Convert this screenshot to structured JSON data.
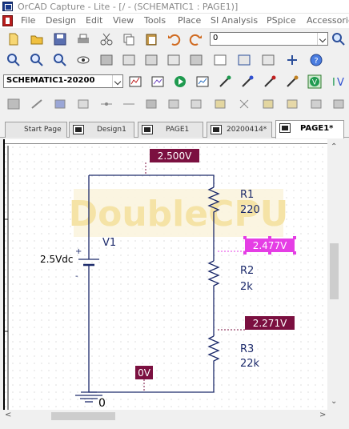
{
  "window": {
    "title": "OrCAD Capture - Lite - [/ - (SCHEMATIC1 : PAGE1)]"
  },
  "menu": [
    "File",
    "Design",
    "Edit",
    "View",
    "Tools",
    "Place",
    "SI Analysis",
    "PSpice",
    "Accessories"
  ],
  "toolbar": {
    "part_combo_value": "0",
    "schematic_combo_value": "SCHEMATIC1-20200"
  },
  "tabs": [
    {
      "label": "Start Page",
      "icon": "none"
    },
    {
      "label": "Design1",
      "icon": "design-icon"
    },
    {
      "label": "PAGE1",
      "icon": "page-icon"
    },
    {
      "label": "20200414*",
      "icon": "design-icon"
    },
    {
      "label": "PAGE1*",
      "icon": "page-icon",
      "active": true
    }
  ],
  "schematic": {
    "watermark": "DoubleCPU",
    "voltage_markers": [
      "2.500V",
      "2.477V",
      "2.271V",
      "0V"
    ],
    "source": {
      "name": "V1",
      "value": "2.5Vdc",
      "plus": "+",
      "minus": "-"
    },
    "resistors": [
      {
        "name": "R1",
        "value": "220"
      },
      {
        "name": "R2",
        "value": "2k"
      },
      {
        "name": "R3",
        "value": "22k"
      }
    ],
    "ground_label": "0"
  },
  "colors": {
    "voltage_marker_bg": "#7b1040",
    "selected_marker_bg": "#e53ee5",
    "wire": "#1c2a6b",
    "watermark": "#f5e3a6"
  }
}
